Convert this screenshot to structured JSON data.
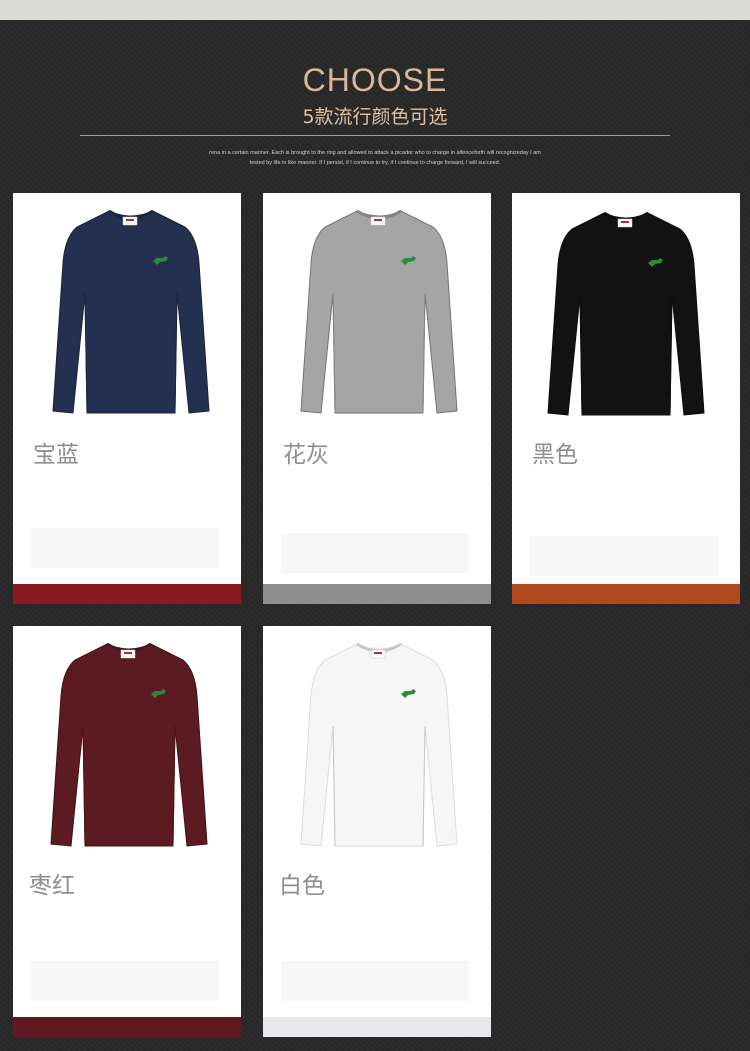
{
  "header": {
    "title": "CHOOSE",
    "subtitle": "5款流行颜色可选",
    "description_line1": "rena in a certain manner. Each is brought to the ring and allowed to attack a picador who to charge in alfenceforth will recognizeday I am",
    "description_line2": "tested by life in like manner. If I persist, if I continue to try, if I continue to charge forward, I will succeed."
  },
  "colors": [
    {
      "label": "宝蓝",
      "shirt_color": "#24304f",
      "bar_color": "#8a1a21"
    },
    {
      "label": "花灰",
      "shirt_color": "#a5a5a5",
      "bar_color": "#8e8e8e"
    },
    {
      "label": "黑色",
      "shirt_color": "#121212",
      "bar_color": "#b04a1e"
    },
    {
      "label": "枣红",
      "shirt_color": "#5c1a22",
      "bar_color": "#621823"
    },
    {
      "label": "白色",
      "shirt_color": "#f6f6f6",
      "bar_color": "#e8e8ec"
    }
  ],
  "icons": {
    "shirt": "long-sleeve-tshirt-icon",
    "logo": "crocodile-logo-icon"
  }
}
